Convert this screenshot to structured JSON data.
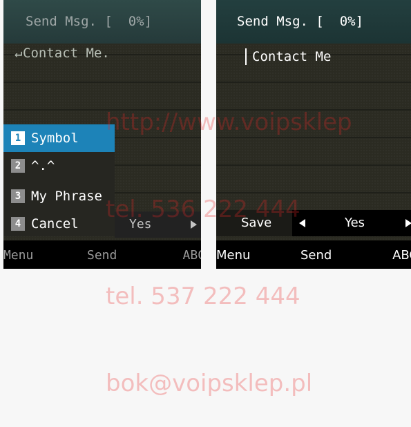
{
  "left_screen": {
    "header": {
      "title": "Send Msg. [  0%]"
    },
    "edit": {
      "cursor_glyph": "↵",
      "text": "Contact Me."
    },
    "popup_menu": [
      {
        "num": "1",
        "label": "Symbol",
        "selected": true
      },
      {
        "num": "2",
        "label": "^.^",
        "selected": false
      },
      {
        "num": "3",
        "label": "My Phrase",
        "selected": false
      },
      {
        "num": "4",
        "label": "Cancel",
        "selected": false
      }
    ],
    "save_value": "Yes",
    "softkeys": {
      "left": "Menu",
      "center": "Send",
      "right": "ABC"
    }
  },
  "right_screen": {
    "header": {
      "title": "Send Msg. [  0%]"
    },
    "edit": {
      "text": "Contact Me"
    },
    "save_row": {
      "label": "Save",
      "value": "Yes"
    },
    "softkeys": {
      "left": "Menu",
      "center": "Send",
      "right": "ABC"
    }
  },
  "watermark": {
    "lines": [
      "http://www.voipsklep",
      "tel. 536 222 444",
      "tel. 537 222 444",
      "bok@voipsklep.pl"
    ]
  },
  "colors": {
    "highlight": "#1d83b8",
    "watermark": "#eb2828"
  }
}
